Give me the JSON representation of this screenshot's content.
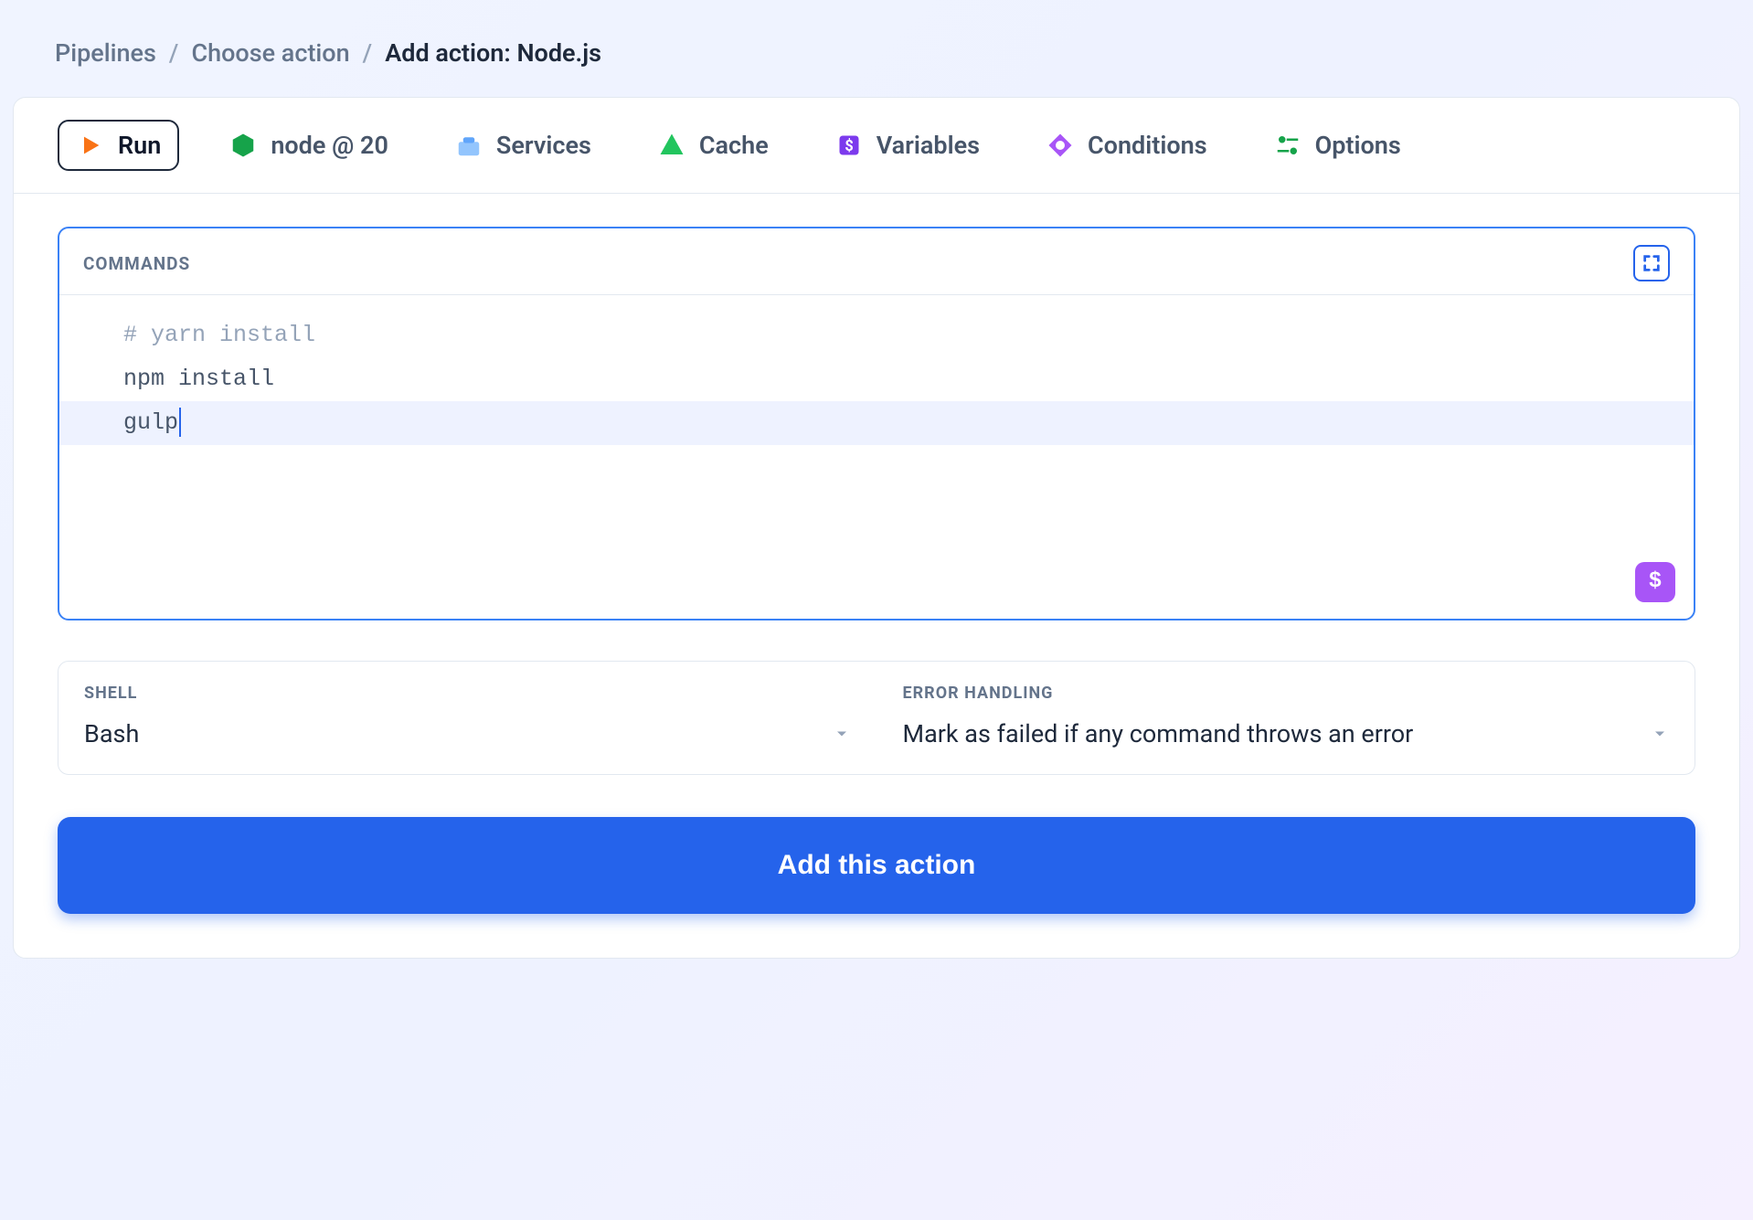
{
  "breadcrumb": {
    "items": [
      "Pipelines",
      "Choose action"
    ],
    "current": "Add action: Node.js"
  },
  "tabs": {
    "run": "Run",
    "node": "node @ 20",
    "services": "Services",
    "cache": "Cache",
    "variables": "Variables",
    "conditions": "Conditions",
    "options": "Options"
  },
  "commands": {
    "label": "COMMANDS",
    "lines": [
      {
        "text": "# yarn install",
        "type": "comment"
      },
      {
        "text": "npm install",
        "type": "normal"
      },
      {
        "text": "gulp",
        "type": "active"
      }
    ]
  },
  "shell": {
    "label": "SHELL",
    "value": "Bash"
  },
  "error_handling": {
    "label": "ERROR HANDLING",
    "value": "Mark as failed if any command throws an error"
  },
  "footer": {
    "add_button": "Add this action"
  },
  "icons": {
    "dollar": "$"
  }
}
